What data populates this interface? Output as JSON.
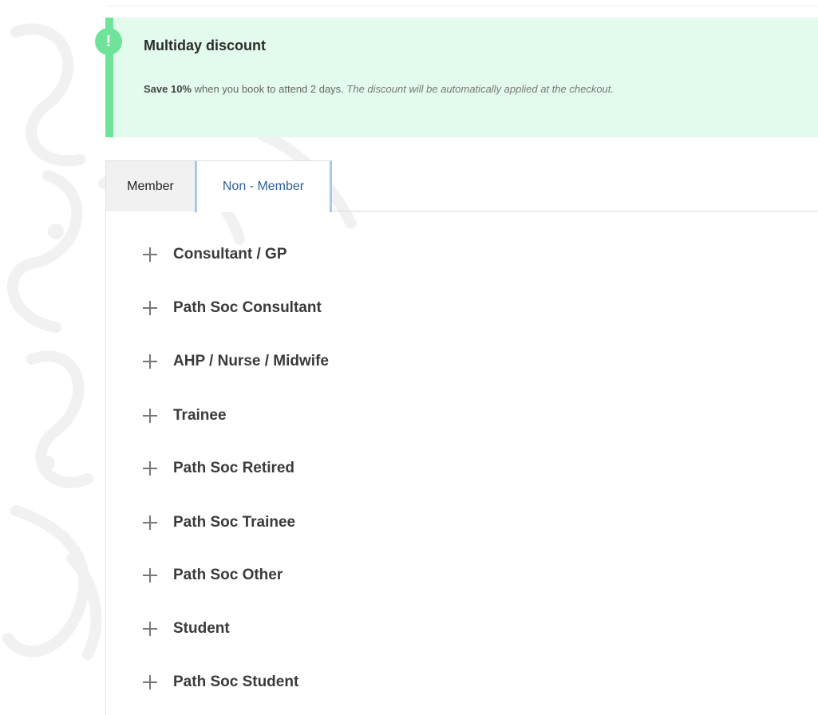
{
  "notice": {
    "badge": "!",
    "title": "Multiday discount",
    "body_bold": "Save 10%",
    "body_text": " when you book to attend 2 days. ",
    "body_italic": "The discount will be automatically applied at the checkout."
  },
  "tabs": [
    {
      "label": "Member",
      "active": false
    },
    {
      "label": "Non - Member",
      "active": true
    }
  ],
  "categories": [
    {
      "label": "Consultant / GP"
    },
    {
      "label": "Path Soc Consultant"
    },
    {
      "label": "AHP / Nurse / Midwife"
    },
    {
      "label": "Trainee"
    },
    {
      "label": "Path Soc Retired"
    },
    {
      "label": "Path Soc Trainee"
    },
    {
      "label": "Path Soc Other"
    },
    {
      "label": "Student"
    },
    {
      "label": "Path Soc Student"
    }
  ],
  "icons": {
    "expand": "plus-icon",
    "notice": "exclamation-icon"
  },
  "colors": {
    "notice_bg": "#e3fbec",
    "notice_accent": "#6fe39a",
    "active_tab_text": "#2f5f9b",
    "active_tab_border": "#a9c8ee"
  }
}
